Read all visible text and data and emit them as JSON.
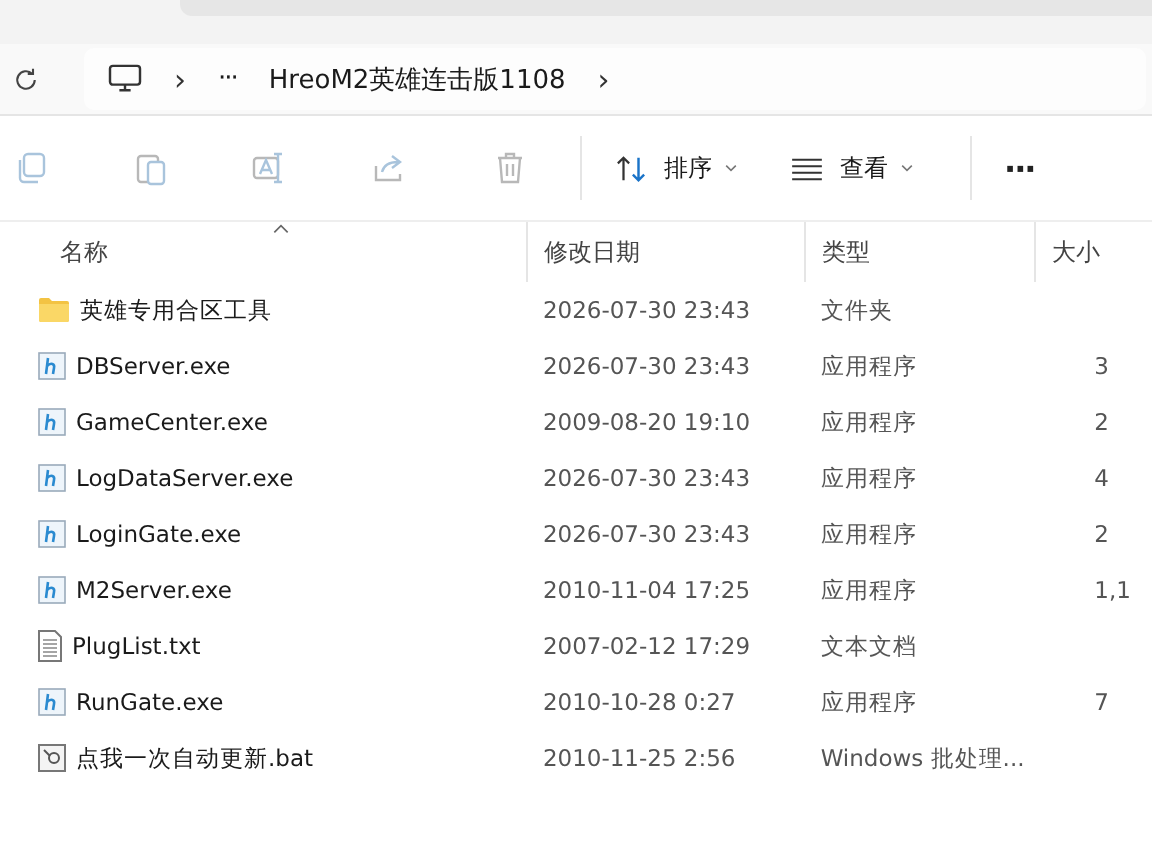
{
  "breadcrumb": {
    "overflow": "···",
    "folder": "HreoM2英雄连击版1108",
    "separators": [
      "›",
      "›"
    ]
  },
  "toolbar": {
    "actions": [
      {
        "kind": "copy",
        "disabled": true
      },
      {
        "kind": "paste",
        "disabled": true
      },
      {
        "kind": "rename",
        "disabled": true
      },
      {
        "kind": "share",
        "disabled": true
      },
      {
        "kind": "delete",
        "disabled": true
      }
    ],
    "sort": "排序",
    "view": "查看",
    "more": "···"
  },
  "table": {
    "columns": [
      {
        "label": "名称",
        "sorted": true
      },
      {
        "label": "修改日期",
        "sorted": false
      },
      {
        "label": "类型",
        "sorted": false
      },
      {
        "label": "大小",
        "sorted": false
      }
    ],
    "rows": [
      {
        "kind": "folder",
        "name": "英雄专用合区工具",
        "date": "2026-07-30 23:43",
        "type": "文件夹"
      },
      {
        "kind": "exe",
        "name": "DBServer.exe",
        "date": "2026-07-30 23:43",
        "type": "应用程序",
        "size": "3"
      },
      {
        "kind": "exe",
        "name": "GameCenter.exe",
        "date": "2009-08-20 19:10",
        "type": "应用程序",
        "size": "2"
      },
      {
        "kind": "exe",
        "name": "LogDataServer.exe",
        "date": "2026-07-30 23:43",
        "type": "应用程序",
        "size": "4"
      },
      {
        "kind": "exe",
        "name": "LoginGate.exe",
        "date": "2026-07-30 23:43",
        "type": "应用程序",
        "size": "2"
      },
      {
        "kind": "exe",
        "name": "M2Server.exe",
        "date": "2010-11-04 17:25",
        "type": "应用程序",
        "size": "1,1"
      },
      {
        "kind": "txt",
        "name": "PlugList.txt",
        "date": "2007-02-12 17:29",
        "type": "文本文档"
      },
      {
        "kind": "exe",
        "name": "RunGate.exe",
        "date": "2010-10-28 0:27",
        "type": "应用程序",
        "size": "7"
      },
      {
        "kind": "bat",
        "name": "点我一次自动更新.bat",
        "date": "2010-11-25 2:56",
        "type": "Windows 批处理..."
      }
    ]
  }
}
